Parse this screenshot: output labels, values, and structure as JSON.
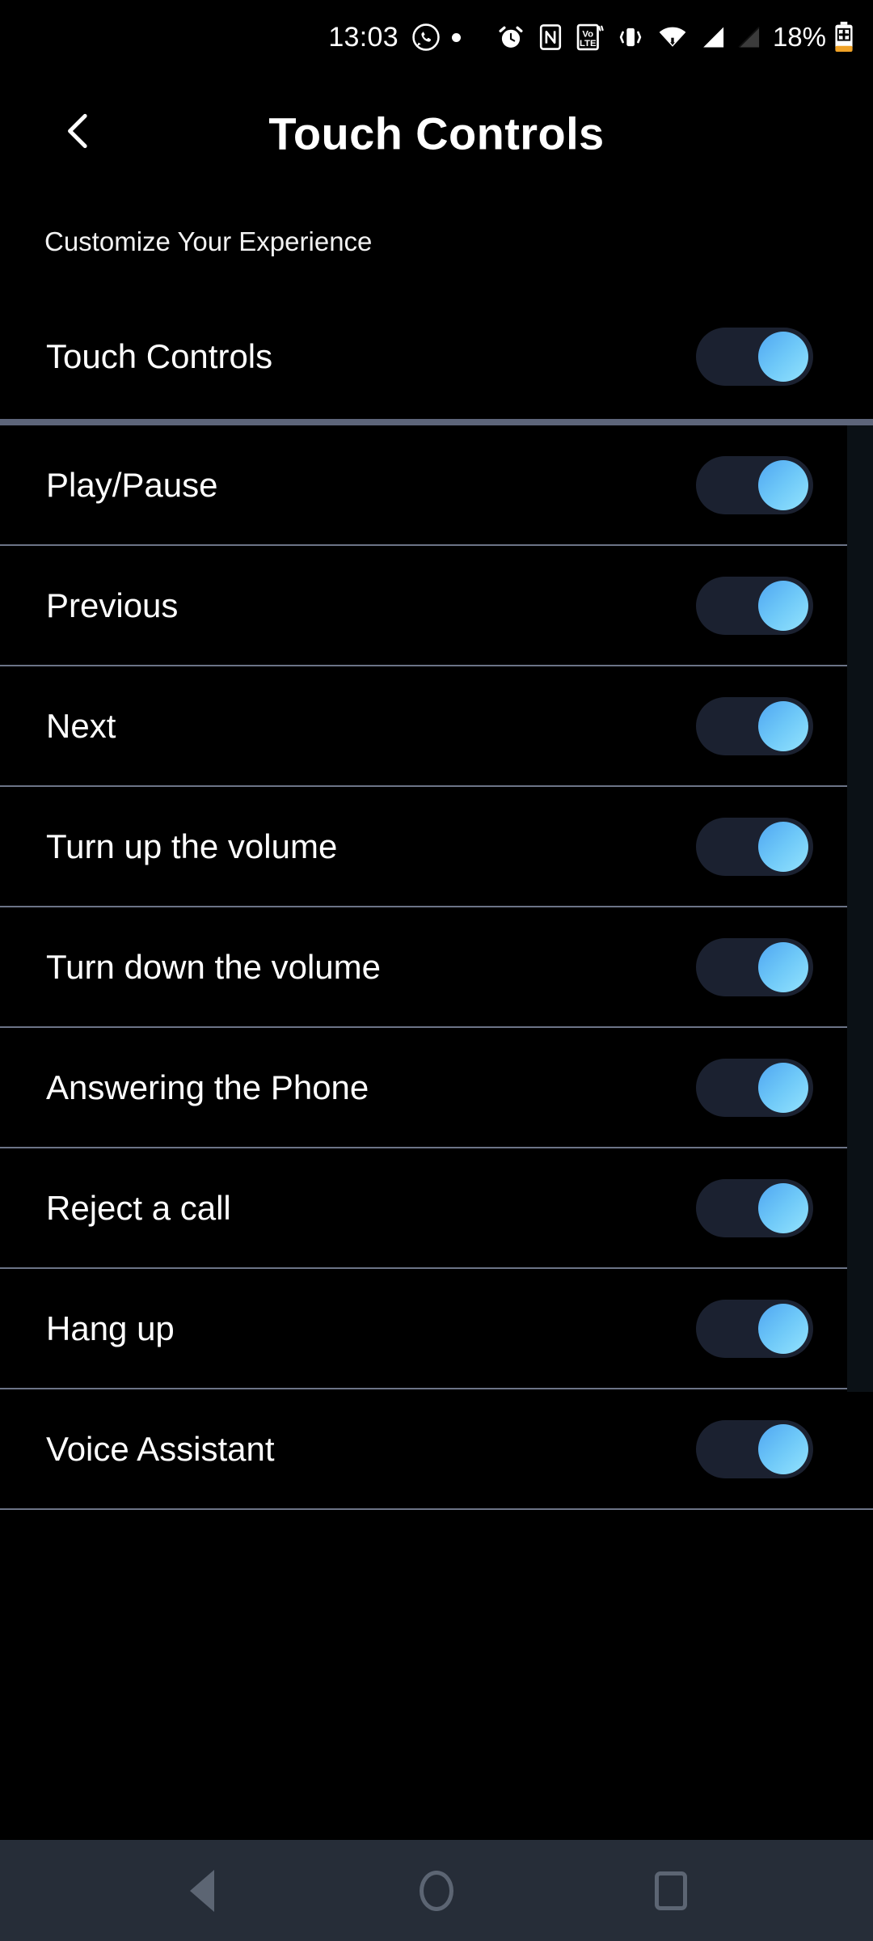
{
  "status_bar": {
    "time": "13:03",
    "battery_percent": "18%",
    "icons": [
      "whatsapp-icon",
      "notification-dot",
      "alarm-icon",
      "nfc-icon",
      "volte-icon",
      "vibrate-icon",
      "wifi-icon",
      "signal-sim1-icon",
      "signal-sim2-icon",
      "battery-charging-icon"
    ]
  },
  "header": {
    "back_icon": "chevron-left-icon",
    "title": "Touch Controls"
  },
  "subtitle": "Customize Your Experience",
  "master": {
    "label": "Touch Controls",
    "enabled": true
  },
  "colors": {
    "background": "#000000",
    "toggle_track": "#1b2130",
    "toggle_thumb": "#6ec8f8",
    "divider": "#6c7487",
    "section_divider": "#5d657a",
    "navbar": "#262d38",
    "navbar_icon": "#5c6573"
  },
  "list": {
    "items": [
      {
        "label": "Play/Pause",
        "enabled": true
      },
      {
        "label": "Previous",
        "enabled": true
      },
      {
        "label": "Next",
        "enabled": true
      },
      {
        "label": "Turn up the volume",
        "enabled": true
      },
      {
        "label": "Turn down the volume",
        "enabled": true
      },
      {
        "label": "Answering the Phone",
        "enabled": true
      },
      {
        "label": "Reject a call",
        "enabled": true
      },
      {
        "label": "Hang up",
        "enabled": true
      },
      {
        "label": "Voice Assistant",
        "enabled": true
      }
    ]
  },
  "navbar": {
    "back": "back-nav-icon",
    "home": "home-nav-icon",
    "recents": "recents-nav-icon"
  }
}
